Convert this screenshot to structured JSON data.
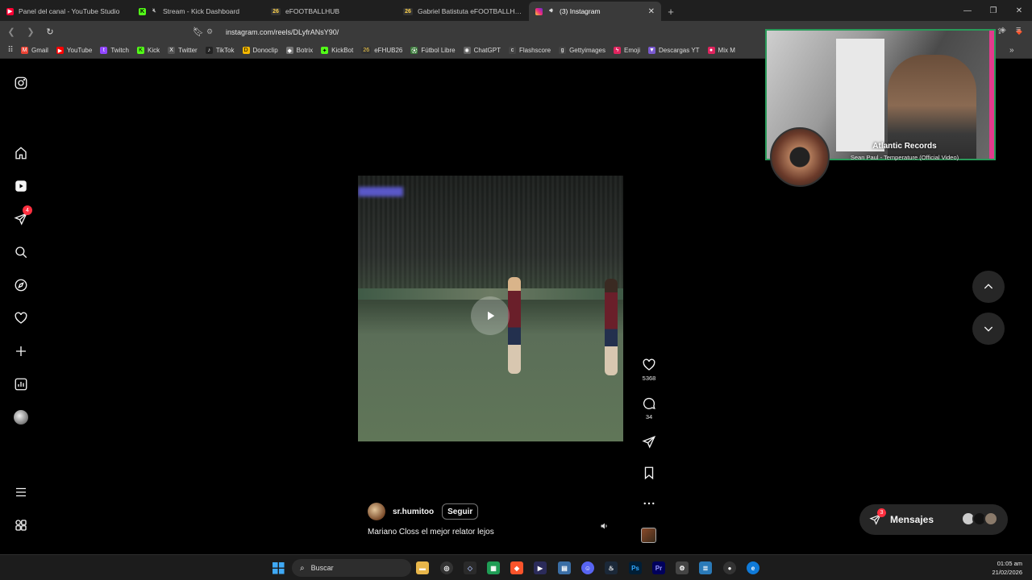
{
  "browser": {
    "tabs": [
      {
        "title": "Panel del canal - YouTube Studio",
        "icon": "youtube-studio-icon",
        "color": "#ff0033"
      },
      {
        "title": "Stream - Kick Dashboard",
        "icon": "kick-icon",
        "color": "#53fc18"
      },
      {
        "title": "eFOOTBALLHUB",
        "icon": "efootballhub-icon",
        "color": "#1c1c1c"
      },
      {
        "title": "Gabriel Batistuta eFOOTBALLHUB Juga",
        "icon": "efootballhub-icon",
        "color": "#1c1c1c"
      },
      {
        "title": "(3) Instagram",
        "icon": "instagram-icon",
        "color": "#d62976"
      }
    ],
    "url": "instagram.com/reels/DLyfrANsY90/",
    "bookmarks": [
      {
        "label": "Gmail",
        "color": "#ea4335"
      },
      {
        "label": "YouTube",
        "color": "#ff0000"
      },
      {
        "label": "Twitch",
        "color": "#9146ff"
      },
      {
        "label": "Kick",
        "color": "#53fc18"
      },
      {
        "label": "Twitter",
        "color": "#555555"
      },
      {
        "label": "TikTok",
        "color": "#222222"
      },
      {
        "label": "Donoclip",
        "color": "#f5b800"
      },
      {
        "label": "Botrix",
        "color": "#777777"
      },
      {
        "label": "KickBot",
        "color": "#53fc18"
      },
      {
        "label": "eFHUB26",
        "color": "#333333"
      },
      {
        "label": "Fútbol Libre",
        "color": "#3a7a3a"
      },
      {
        "label": "ChatGPT",
        "color": "#666666"
      },
      {
        "label": "Flashscore",
        "color": "#444444"
      },
      {
        "label": "Gettyimages",
        "color": "#444444"
      },
      {
        "label": "Emoji",
        "color": "#e0245e"
      },
      {
        "label": "Descargas YT",
        "color": "#7a5ad0"
      },
      {
        "label": "Mix M",
        "color": "#e0245e"
      }
    ]
  },
  "instagram": {
    "notifications_badge": "4",
    "reel": {
      "username": "sr.humitoo",
      "follow_label": "Seguir",
      "caption": "Mariano Closs el mejor relator lejos",
      "likes": "5368",
      "comments": "34"
    },
    "messages": {
      "label": "Mensajes",
      "badge": "3"
    }
  },
  "overlay": {
    "artist": "Atlantic Records",
    "track": "Sean Paul - Temperature (Official Video)"
  },
  "taskbar": {
    "search_placeholder": "Buscar",
    "time": "01:05 am",
    "date": "21/02/2026"
  }
}
